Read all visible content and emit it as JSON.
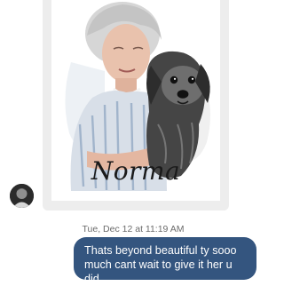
{
  "post": {
    "artwork_caption": "Norma"
  },
  "message": {
    "timestamp": "Tue, Dec 12 at 11:19 AM",
    "text": "Thats beyond beautiful ty sooo much cant wait to give it her u did"
  },
  "colors": {
    "bubble": "#34557f",
    "card_frame": "#ededed"
  }
}
